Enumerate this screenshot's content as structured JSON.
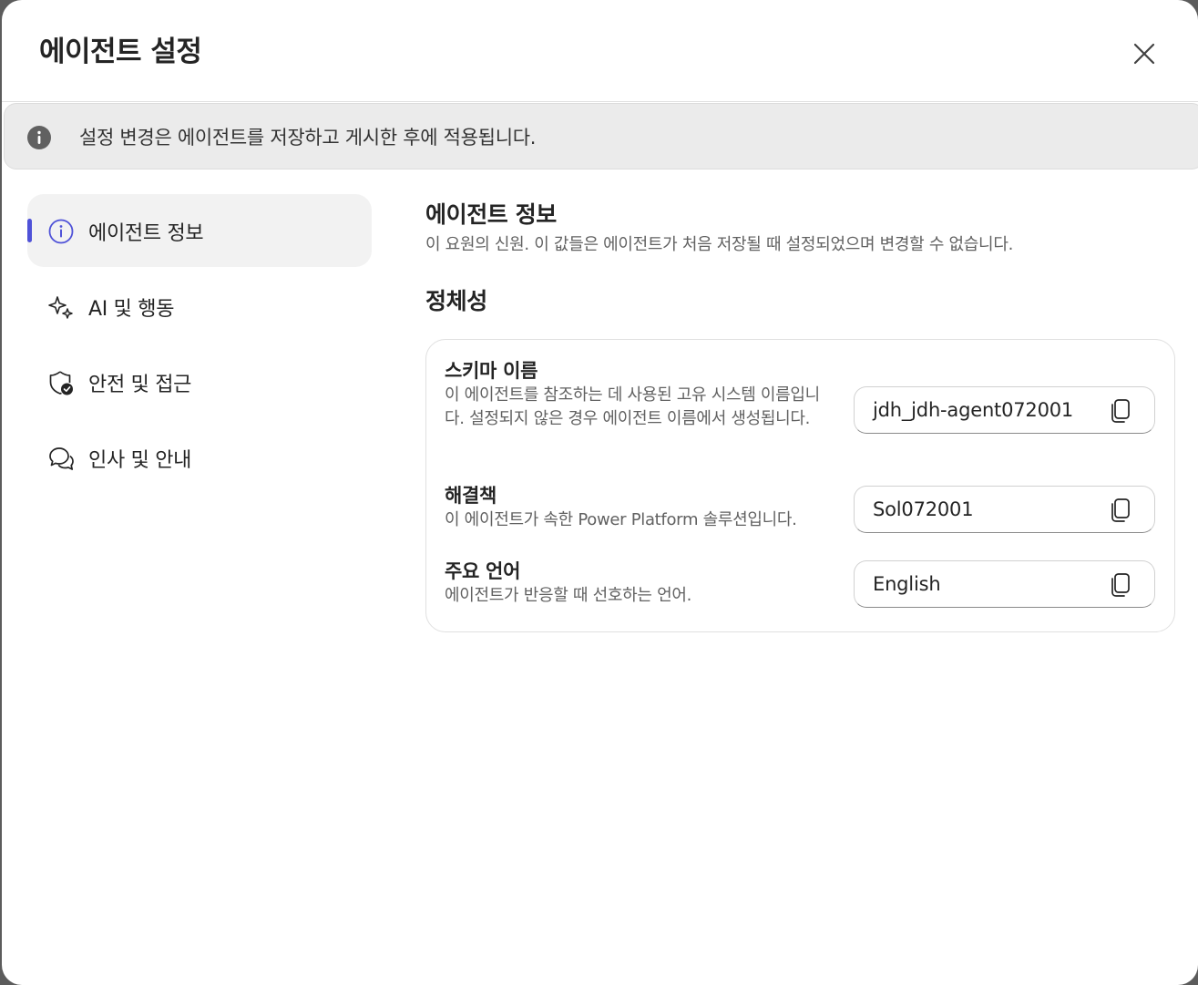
{
  "dialog": {
    "title": "에이전트 설정",
    "close_icon": "close-icon"
  },
  "banner": {
    "icon": "info-filled-icon",
    "text": "설정 변경은 에이전트를 저장하고 게시한 후에 적용됩니다."
  },
  "sidebar": {
    "items": [
      {
        "label": "에이전트 정보",
        "icon": "info-icon",
        "active": true
      },
      {
        "label": "AI 및 행동",
        "icon": "sparkle-icon",
        "active": false
      },
      {
        "label": "안전 및 접근",
        "icon": "shield-check-icon",
        "active": false
      },
      {
        "label": "인사 및 안내",
        "icon": "chat-bubbles-icon",
        "active": false
      }
    ]
  },
  "main": {
    "title": "에이전트 정보",
    "description": "이 요원의 신원. 이 값들은 에이전트가 처음 저장될 때 설정되었으며 변경할 수 없습니다.",
    "section_title": "정체성",
    "fields": [
      {
        "label": "스키마 이름",
        "description": "이 에이전트를 참조하는 데 사용된 고유 시스템 이름입니다. 설정되지 않은 경우 에이전트 이름에서 생성됩니다.",
        "value": "jdh_jdh-agent072001"
      },
      {
        "label": "해결책",
        "description": "이 에이전트가 속한 Power Platform 솔루션입니다.",
        "value": "Sol072001"
      },
      {
        "label": "주요 언어",
        "description": "에이전트가 반응할 때 선호하는 언어.",
        "value": "English"
      }
    ]
  },
  "colors": {
    "accent": "#4f52d8",
    "banner_bg": "#ebebeb",
    "active_nav_bg": "#f2f2f2"
  }
}
